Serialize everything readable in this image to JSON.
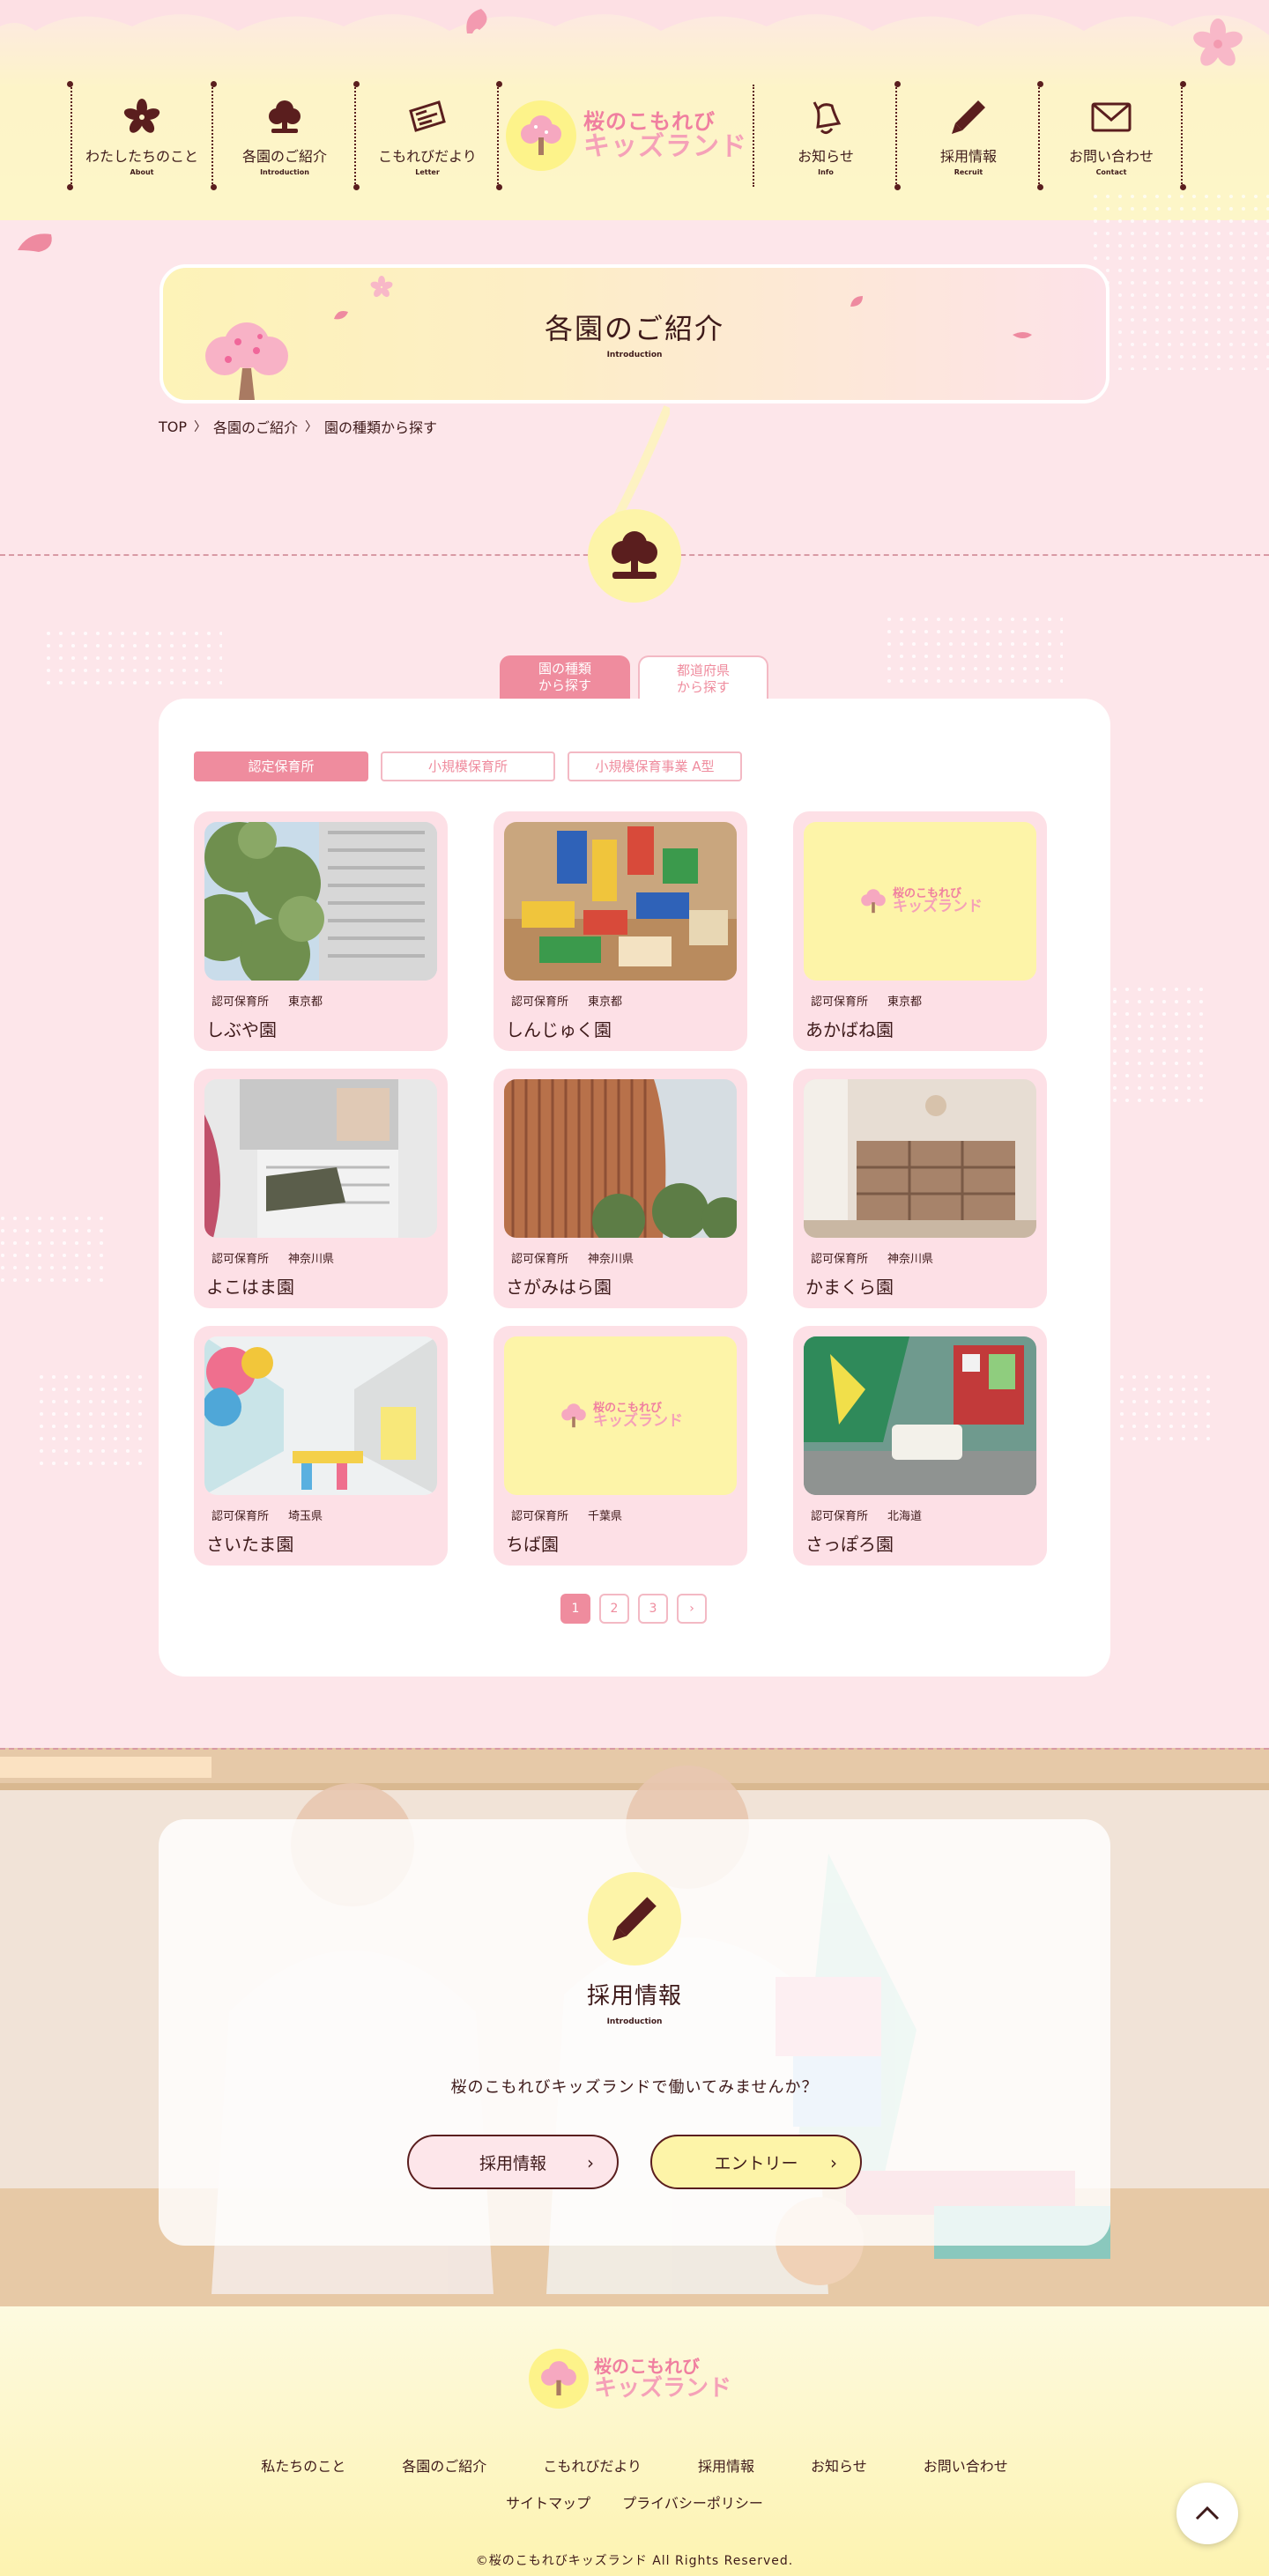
{
  "nav": {
    "items": [
      {
        "label": "わたしたちのこと",
        "sub": "About",
        "icon": "sakura-flower-icon"
      },
      {
        "label": "各園のご紹介",
        "sub": "Introduction",
        "icon": "tree-icon"
      },
      {
        "label": "こもれびだより",
        "sub": "Letter",
        "icon": "newspaper-icon"
      },
      {
        "label": "お知らせ",
        "sub": "Info",
        "icon": "bell-icon"
      },
      {
        "label": "採用情報",
        "sub": "Recruit",
        "icon": "pencil-icon"
      },
      {
        "label": "お問い合わせ",
        "sub": "Contact",
        "icon": "envelope-icon"
      }
    ]
  },
  "logo": {
    "line1": "桜のこもれび",
    "line2": "キッズランド"
  },
  "page": {
    "title": "各園のご紹介",
    "subtitle": "Introduction"
  },
  "breadcrumb": [
    "TOP",
    "各園のご紹介",
    "園の種類から探す"
  ],
  "tabs": [
    {
      "line1": "園の種類",
      "line2": "から探す",
      "active": true
    },
    {
      "line1": "都道府県",
      "line2": "から探す",
      "active": false
    }
  ],
  "filters": [
    {
      "label": "認定保育所",
      "active": true
    },
    {
      "label": "小規模保育所",
      "active": false
    },
    {
      "label": "小規模保育事業 A型",
      "active": false
    }
  ],
  "nurseries": [
    {
      "type": "認可保育所",
      "pref": "東京都",
      "name": "しぶや園",
      "image": "building-photo"
    },
    {
      "type": "認可保育所",
      "pref": "東京都",
      "name": "しんじゅく園",
      "image": "blocks-photo"
    },
    {
      "type": "認可保育所",
      "pref": "東京都",
      "name": "あかばね園",
      "image": "logo-placeholder"
    },
    {
      "type": "認可保育所",
      "pref": "神奈川県",
      "name": "よこはま園",
      "image": "shoes-photo"
    },
    {
      "type": "認可保育所",
      "pref": "神奈川県",
      "name": "さがみはら園",
      "image": "wood-building-photo"
    },
    {
      "type": "認可保育所",
      "pref": "神奈川県",
      "name": "かまくら園",
      "image": "classroom-photo"
    },
    {
      "type": "認可保育所",
      "pref": "埼玉県",
      "name": "さいたま園",
      "image": "hallway-photo"
    },
    {
      "type": "認可保育所",
      "pref": "千葉県",
      "name": "ちば園",
      "image": "logo-placeholder"
    },
    {
      "type": "認可保育所",
      "pref": "北海道",
      "name": "さっぽろ園",
      "image": "lobby-photo"
    }
  ],
  "pagination": {
    "pages": [
      "1",
      "2",
      "3"
    ],
    "current": "1",
    "next": "›"
  },
  "recruit": {
    "title": "採用情報",
    "subtitle": "Introduction",
    "text": "桜のこもれびキッズランドで働いてみませんか？",
    "btn_recruit": "採用情報",
    "btn_entry": "エントリー"
  },
  "footer": {
    "links": [
      "私たちのこと",
      "各園のご紹介",
      "こもれびだより",
      "採用情報",
      "お知らせ",
      "お問い合わせ"
    ],
    "links2": [
      "サイトマップ",
      "プライバシーポリシー"
    ],
    "copyright": "©桜のこもれびキッズランド All Rights Reserved."
  },
  "colors": {
    "accent": "#ef8c9e",
    "text": "#3e1a1a",
    "yellow": "#fdf4a8",
    "pink_bg": "#fde6ea"
  }
}
